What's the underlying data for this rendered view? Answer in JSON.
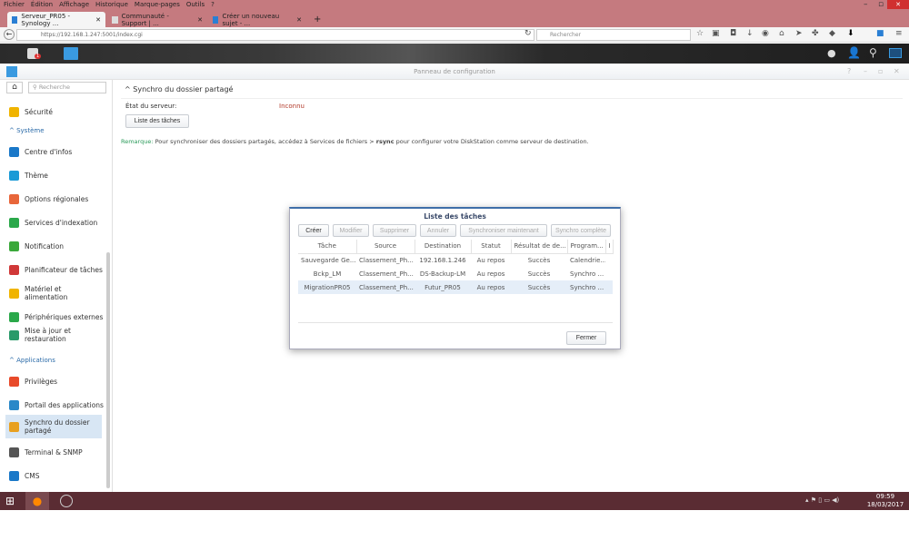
{
  "browser": {
    "menu": [
      "Fichier",
      "Édition",
      "Affichage",
      "Historique",
      "Marque-pages",
      "Outils",
      "?"
    ],
    "tabs": [
      "Serveur_PR05 - Synology ...",
      "Communauté - Support | ...",
      "Créer un nouveau sujet - ..."
    ],
    "new_tab": "+",
    "url": "https://192.168.1.247:5001/index.cgi",
    "search_placeholder": "Rechercher"
  },
  "dsm": {
    "notif_count": "1",
    "window_title": "Panneau de configuration"
  },
  "sidebar": {
    "search_placeholder": "Recherche",
    "items": [
      {
        "label": "Sécurité",
        "color": "#f0b400"
      },
      {
        "header": "Système"
      },
      {
        "label": "Centre d'infos",
        "color": "#1a78c8"
      },
      {
        "label": "Thème",
        "color": "#1a9ad6"
      },
      {
        "label": "Options régionales",
        "color": "#e8663a"
      },
      {
        "label": "Services d'indexation",
        "color": "#2aa84a"
      },
      {
        "label": "Notification",
        "color": "#3aa83a"
      },
      {
        "label": "Planificateur de tâches",
        "color": "#d03838"
      },
      {
        "label": "Matériel et alimentation",
        "color": "#f0b400"
      },
      {
        "label": "Périphériques externes",
        "color": "#2aa84a"
      },
      {
        "label": "Mise à jour et restauration",
        "color": "#2a9a6a"
      },
      {
        "header": "Applications"
      },
      {
        "label": "Privilèges",
        "color": "#e84a2a"
      },
      {
        "label": "Portail des applications",
        "color": "#2a88c8"
      },
      {
        "label": "Synchro du dossier partagé",
        "color": "#e8a020",
        "selected": true
      },
      {
        "label": "Terminal & SNMP",
        "color": "#555555"
      },
      {
        "label": "CMS",
        "color": "#1a78c8"
      }
    ]
  },
  "main": {
    "section_title": "Synchro du dossier partagé",
    "server_state_label": "État du serveur:",
    "server_state_value": "Inconnu",
    "task_list_button": "Liste des tâches",
    "note_label": "Remarque:",
    "note_text": " Pour synchroniser des dossiers partagés, accédez à Services de fichiers > ",
    "note_bold": "rsync",
    "note_tail": " pour configurer votre DiskStation comme serveur de destination."
  },
  "dialog": {
    "title": "Liste des tâches",
    "buttons": [
      "Créer",
      "Modifier",
      "Supprimer",
      "Annuler",
      "Synchroniser maintenant",
      "Synchro complète"
    ],
    "columns": [
      "Tâche",
      "Source",
      "Destination",
      "Statut",
      "Résultat de de...",
      "Program...",
      "I"
    ],
    "rows": [
      [
        "Sauvegarde Ge...",
        "Classement_Ph...",
        "192.168.1.246",
        "Au repos",
        "Succès",
        "Calendrie..."
      ],
      [
        "Bckp_LM",
        "Classement_Ph...",
        "DS-Backup-LM",
        "Au repos",
        "Succès",
        "Synchro ..."
      ],
      [
        "MigrationPR05",
        "Classement_Ph...",
        "Futur_PR05",
        "Au repos",
        "Succès",
        "Synchro ..."
      ]
    ],
    "close": "Fermer"
  },
  "taskbar": {
    "time": "09:59",
    "date": "18/03/2017"
  }
}
